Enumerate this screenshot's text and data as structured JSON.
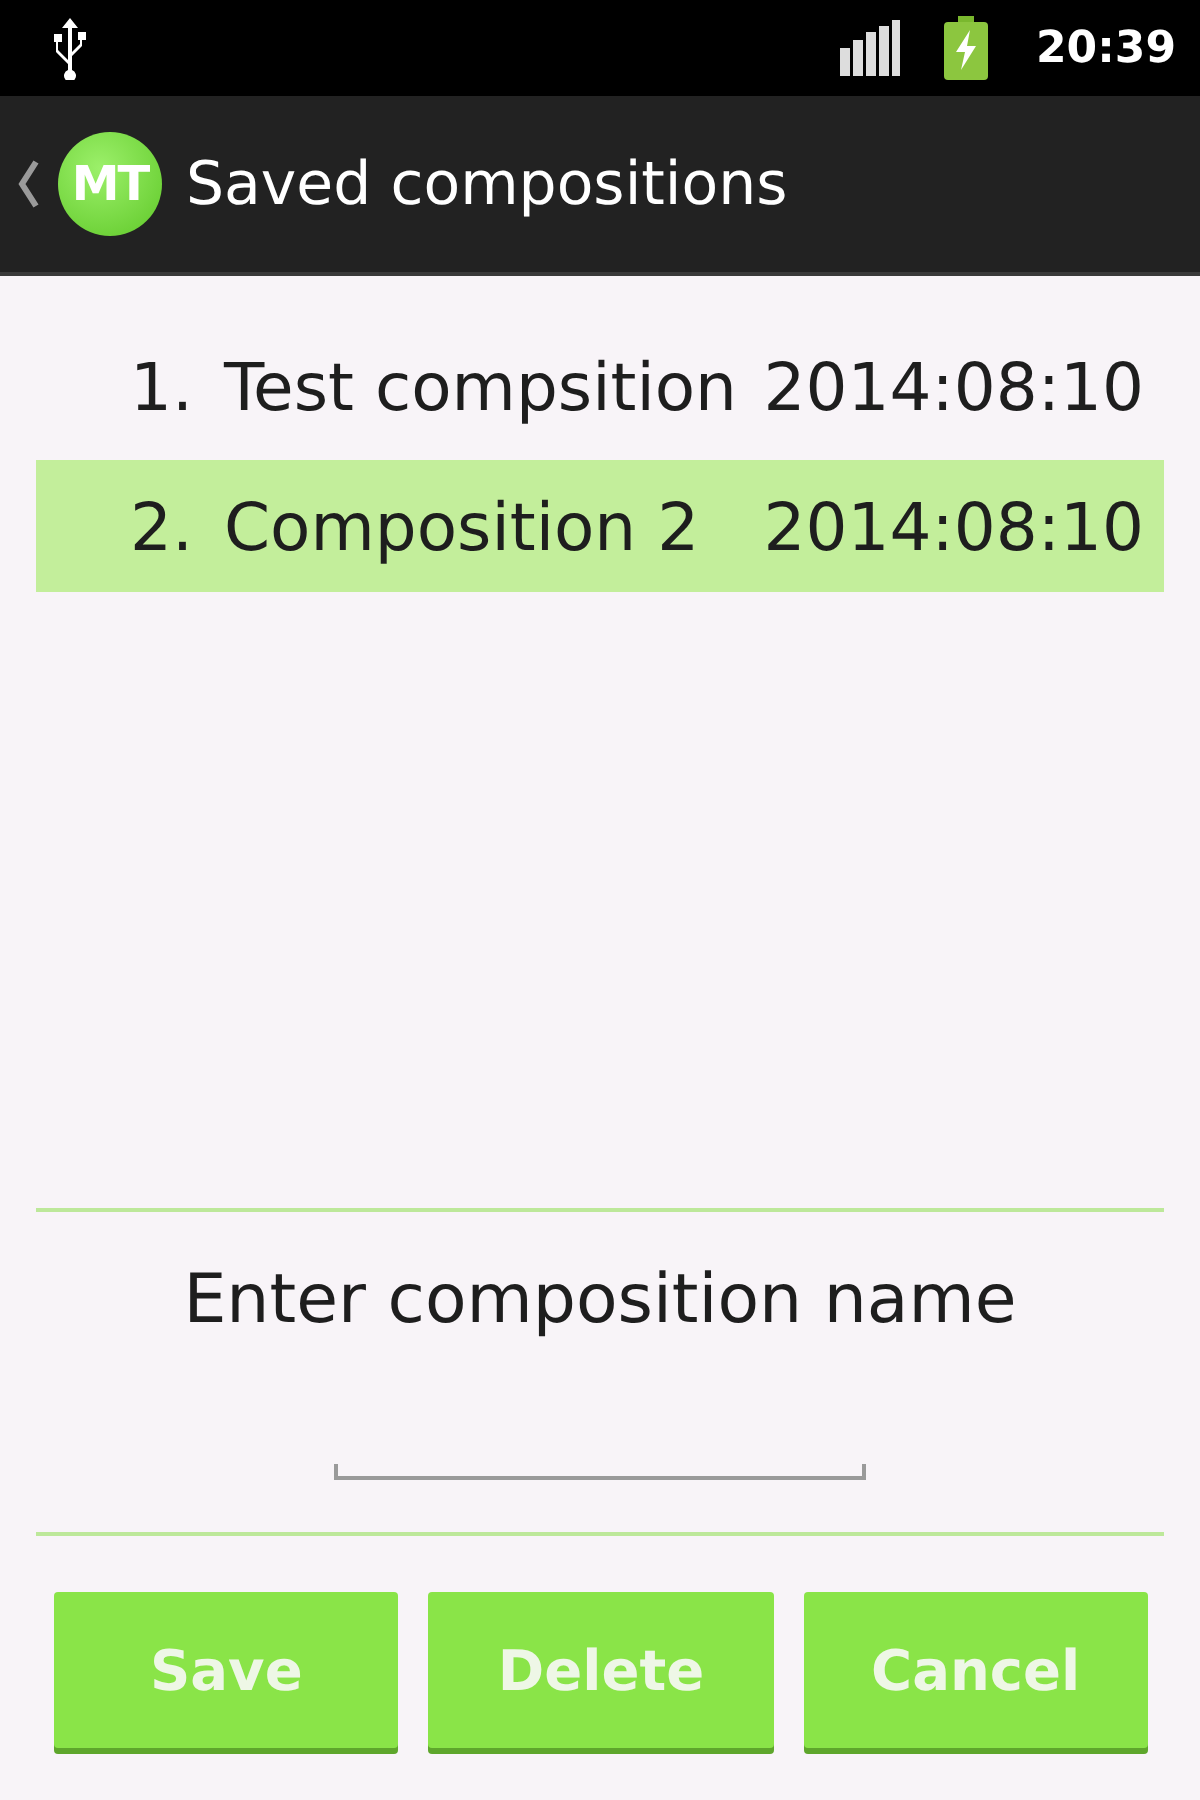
{
  "status_bar": {
    "time": "20:39"
  },
  "action_bar": {
    "logo_text": "MT",
    "title": "Saved compositions"
  },
  "compositions": [
    {
      "number": "1.",
      "name": "Test compsition",
      "date": "2014:08:10",
      "selected": false
    },
    {
      "number": "2.",
      "name": "Composition 2",
      "date": "2014:08:10",
      "selected": true
    }
  ],
  "name_entry": {
    "label": "Enter composition name"
  },
  "buttons": [
    "Save",
    "Delete",
    "Cancel"
  ]
}
